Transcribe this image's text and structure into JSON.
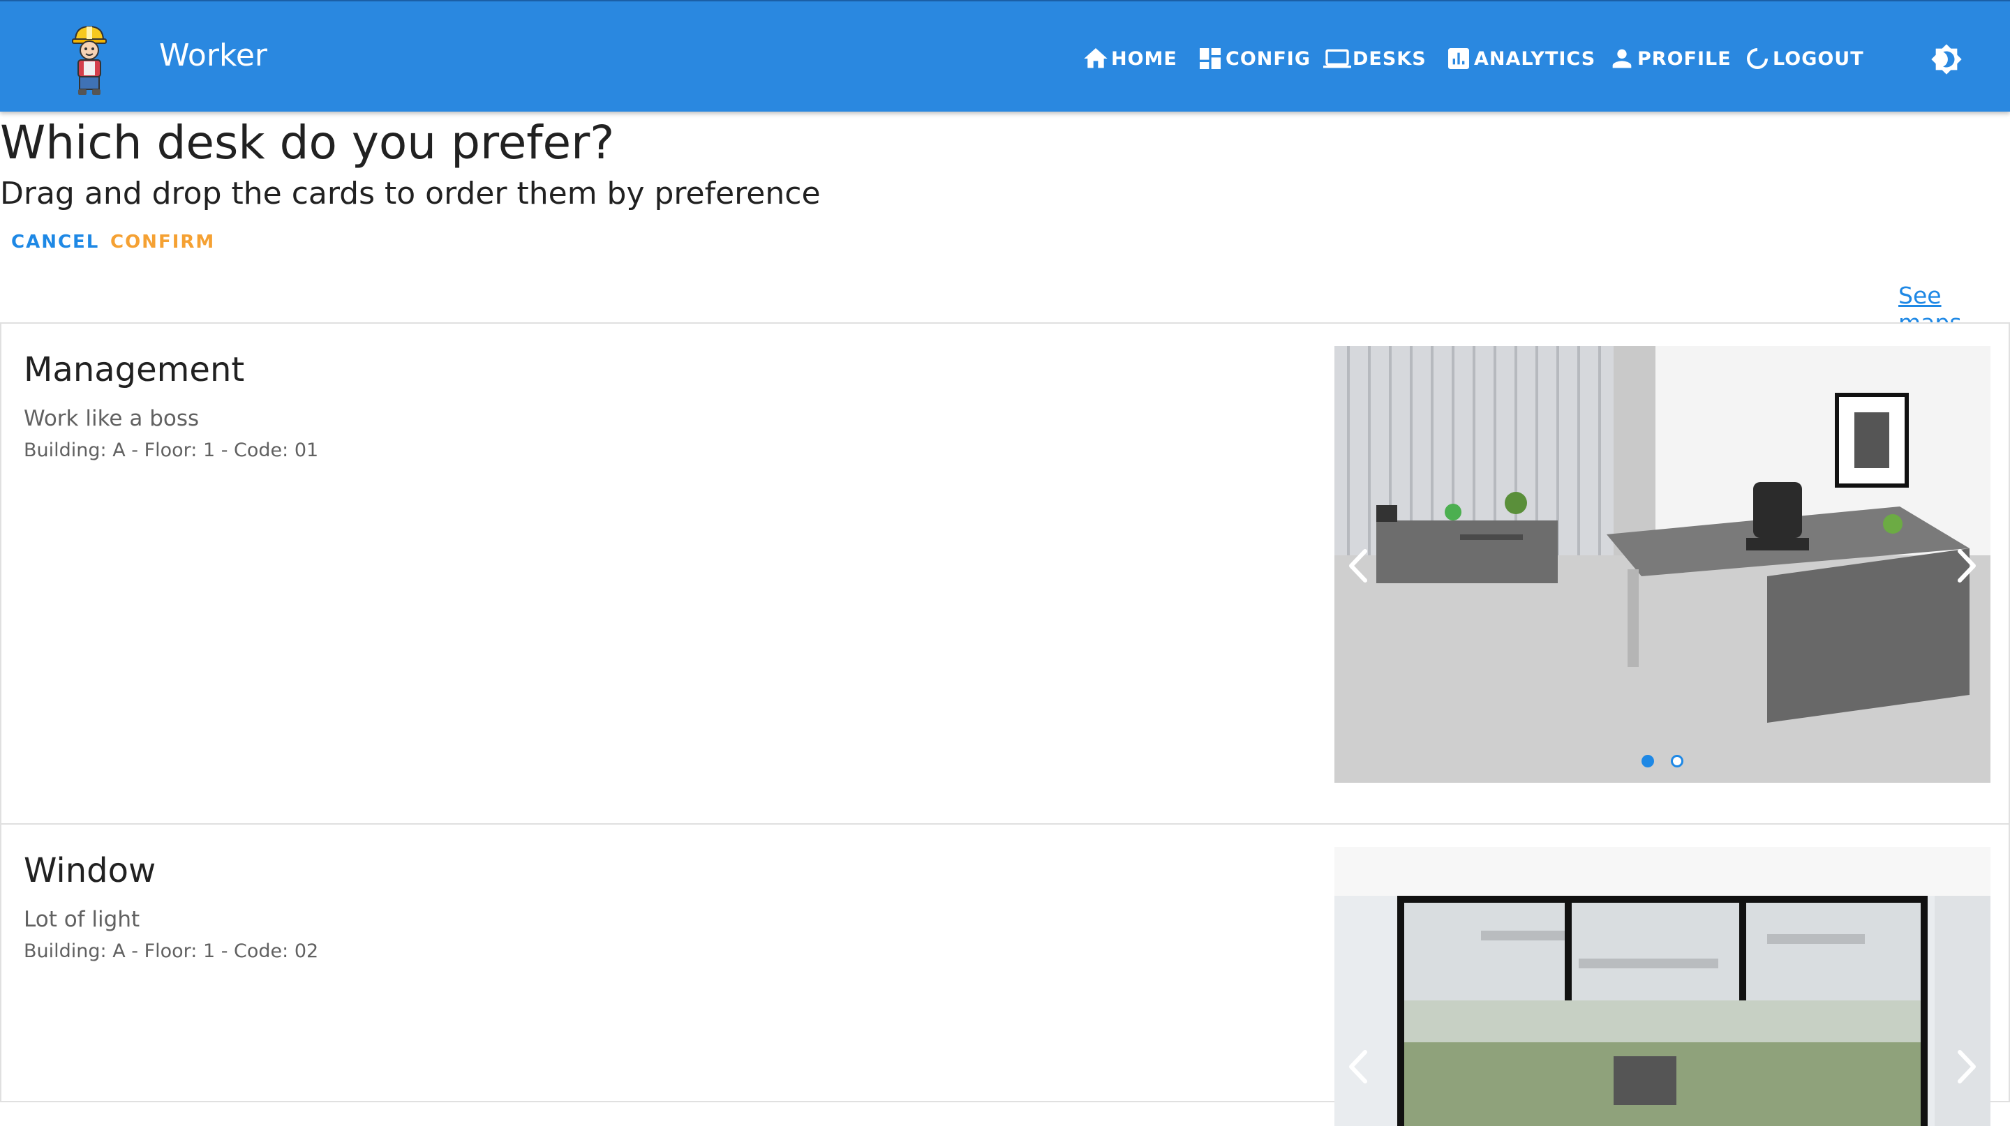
{
  "app": {
    "title": "Worker"
  },
  "nav": {
    "home": "HOME",
    "config": "CONFIG",
    "desks": "DESKS",
    "analytics": "ANALYTICS",
    "profile": "PROFILE",
    "logout": "LOGOUT"
  },
  "page": {
    "title": "Which desk do you prefer?",
    "subtitle": "Drag and drop the cards to order them by preference",
    "cancel": "CANCEL",
    "confirm": "CONFIRM",
    "see_maps": "See maps"
  },
  "cards": [
    {
      "title": "Management",
      "description": "Work like a boss",
      "location": "Building: A - Floor: 1 - Code: 01",
      "image": "office-desk-photo",
      "slides": 2,
      "active_slide": 1
    },
    {
      "title": "Window",
      "description": "Lot of light",
      "location": "Building: A - Floor: 1 - Code: 02",
      "image": "window-office-photo"
    }
  ],
  "colors": {
    "appbar": "#2a88e0",
    "primary": "#1e88e5",
    "accent": "#f5a133"
  }
}
